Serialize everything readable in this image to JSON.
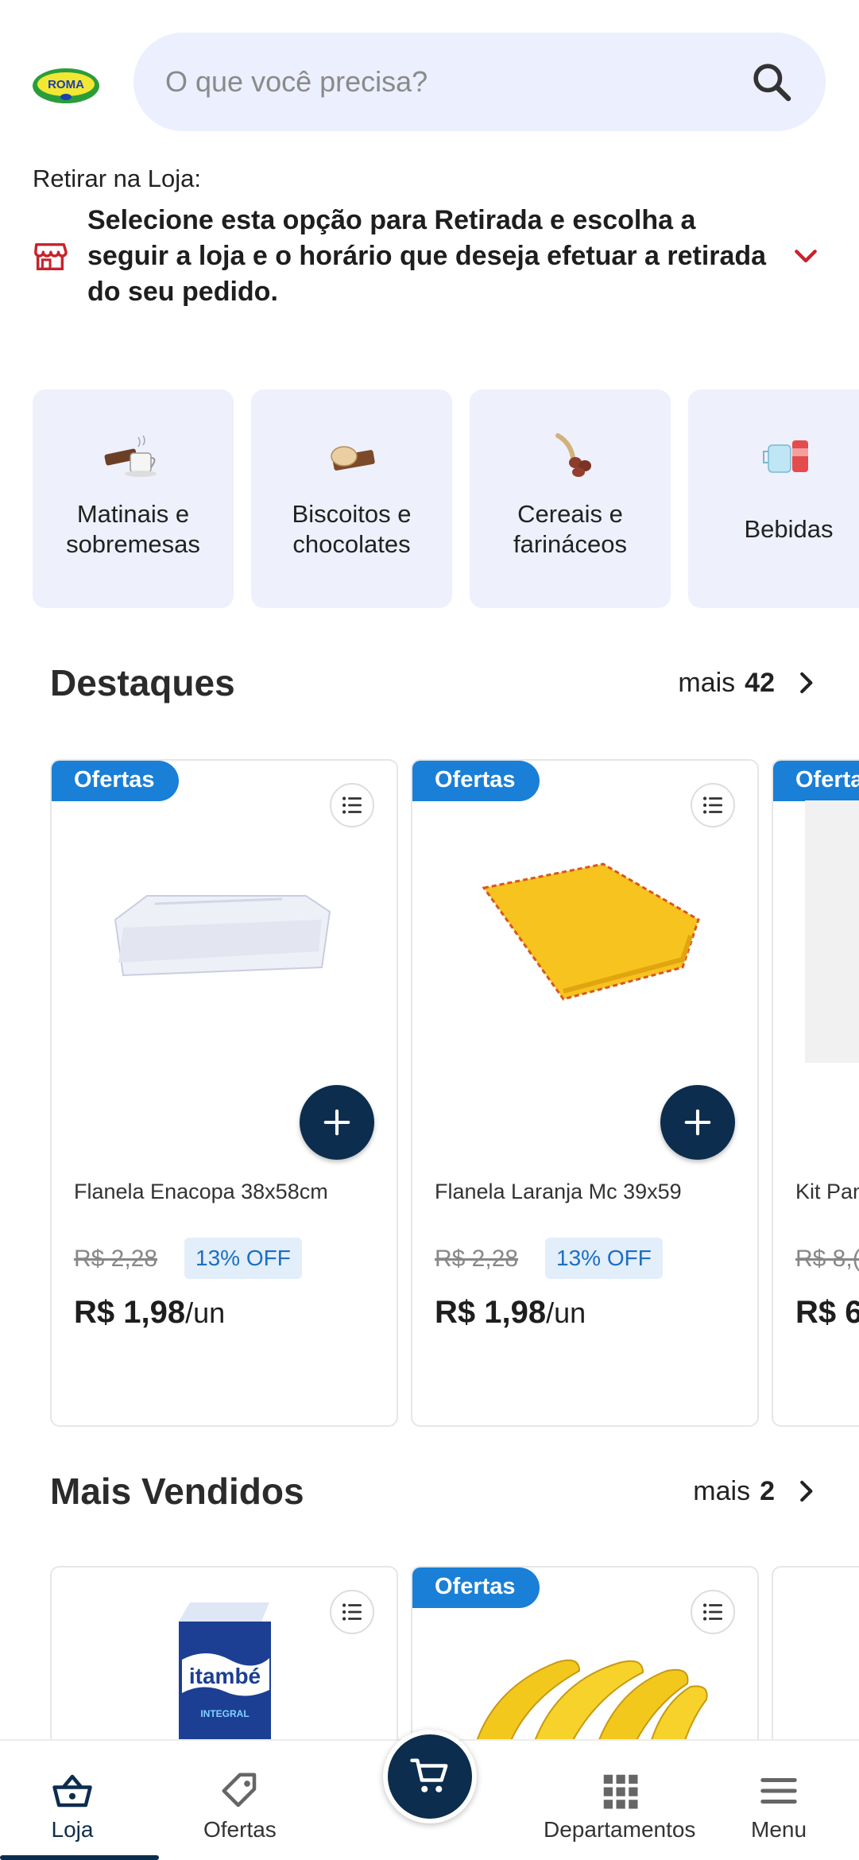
{
  "search": {
    "placeholder": "O que você precisa?"
  },
  "logo": {
    "text": "ROMA"
  },
  "pickup": {
    "label": "Retirar na Loja:",
    "message": "Selecione esta opção para Retirada e escolha a seguir a loja e o horário que deseja efetuar a retirada do seu pedido."
  },
  "categories": [
    {
      "label": "Matinais e sobremesas",
      "icon": "coffee-icon"
    },
    {
      "label": "Biscoitos e chocolates",
      "icon": "biscuit-icon"
    },
    {
      "label": "Cereais e farináceos",
      "icon": "cereal-icon"
    },
    {
      "label": "Bebidas",
      "icon": "drinks-icon"
    }
  ],
  "highlights": {
    "title": "Destaques",
    "more_label": "mais",
    "more_count": "42",
    "products": [
      {
        "badge": "Ofertas",
        "name": "Flanela Enacopa 38x58cm",
        "old_price": "R$ 2,28",
        "discount": "13% OFF",
        "price": "R$ 1,98",
        "unit": "/un"
      },
      {
        "badge": "Ofertas",
        "name": "Flanela Laranja Mc 39x59",
        "old_price": "R$ 2,28",
        "discount": "13% OFF",
        "price": "R$ 1,98",
        "unit": "/un"
      },
      {
        "badge": "Oferta",
        "name": "Kit Pan Microf",
        "old_price": "R$ 8,(",
        "discount": "",
        "price": "R$ 6",
        "unit": ""
      }
    ]
  },
  "best_sellers": {
    "title": "Mais Vendidos",
    "more_label": "mais",
    "more_count": "2",
    "products": [
      {
        "badge": "",
        "brand": "itambé",
        "subtitle": "INTEGRAL"
      },
      {
        "badge": "Ofertas"
      }
    ]
  },
  "bottom_nav": {
    "items": [
      {
        "label": "Loja",
        "icon": "basket-icon",
        "active": true
      },
      {
        "label": "Ofertas",
        "icon": "tag-icon",
        "active": false
      },
      {
        "label": "Departamentos",
        "icon": "grid-icon",
        "active": false
      },
      {
        "label": "Menu",
        "icon": "menu-icon",
        "active": false
      }
    ],
    "cart_icon": "cart-icon"
  },
  "colors": {
    "primary_dark": "#0c2d4d",
    "badge_blue": "#1a7fd6",
    "search_bg": "#eceffd",
    "category_bg": "#eef0fc",
    "accent_red": "#c8232c"
  }
}
